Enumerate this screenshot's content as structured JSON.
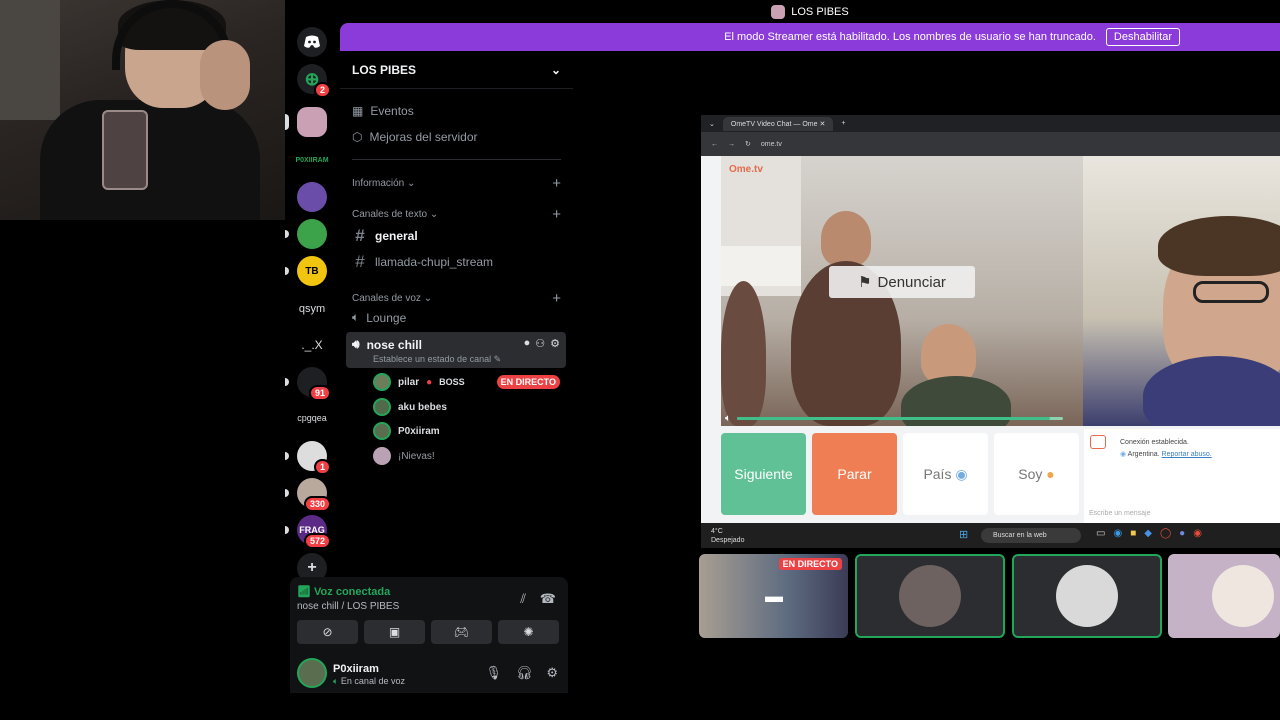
{
  "topline": {
    "title": "LOS PIBES"
  },
  "banner": {
    "message": "El modo Streamer está habilitado. Los nombres de usuario se han truncado.",
    "button_label": "Deshabilitar"
  },
  "servers": [
    {
      "label": "qsym"
    },
    {
      "label": "._.X"
    },
    {
      "label": "cpgqea"
    },
    {
      "label": "FRAG"
    }
  ],
  "server_badges": [
    "2",
    "1",
    "91",
    "1",
    "330",
    "572"
  ],
  "guild": {
    "name": "LOS PIBES",
    "events": "Eventos",
    "boosts": "Mejoras del servidor",
    "categories": {
      "info": "Información",
      "text": "Canales de texto",
      "voice": "Canales de voz"
    },
    "text_channels": [
      "general",
      "llamada-chupi_stream"
    ],
    "voice_channels": {
      "lounge": "Lounge",
      "active": "nose chill",
      "active_status": "Establece un estado de canal"
    },
    "members": [
      {
        "name": "pilar",
        "tag": "BOSS",
        "live": "EN DIRECTO"
      },
      {
        "name": "aku bebes"
      },
      {
        "name": "P0xiiram"
      },
      {
        "name": "¡Nievas!"
      }
    ]
  },
  "voice_panel": {
    "status": "Voz conectada",
    "location": "nose chill / LOS PIBES"
  },
  "user_panel": {
    "name": "P0xiiram",
    "status": "En canal de voz"
  },
  "stream": {
    "tab_title": "OmeTV Video Chat — Ome",
    "url": "ome.tv",
    "logo": "Ome.tv",
    "report_label": "Denunciar",
    "progress": 0.96,
    "actions": {
      "next": "Siguiente",
      "stop": "Parar",
      "country": "País",
      "gender": "Soy"
    },
    "chat": {
      "line1": "Conexión establecida.",
      "line2": "Argentina.",
      "report_link": "Reportar abuso.",
      "placeholder": "Escribe un mensaje"
    },
    "taskbar": {
      "temp": "4°C",
      "weather": "Despejado",
      "search": "Buscar en la web"
    }
  },
  "tiles": {
    "live": "EN DIRECTO"
  },
  "colors": {
    "brand_purple": "#8c3bdb",
    "online_green": "#23a55a",
    "live_red": "#ed4245",
    "next_green": "#5fc195",
    "stop_orange": "#ef7e55"
  }
}
